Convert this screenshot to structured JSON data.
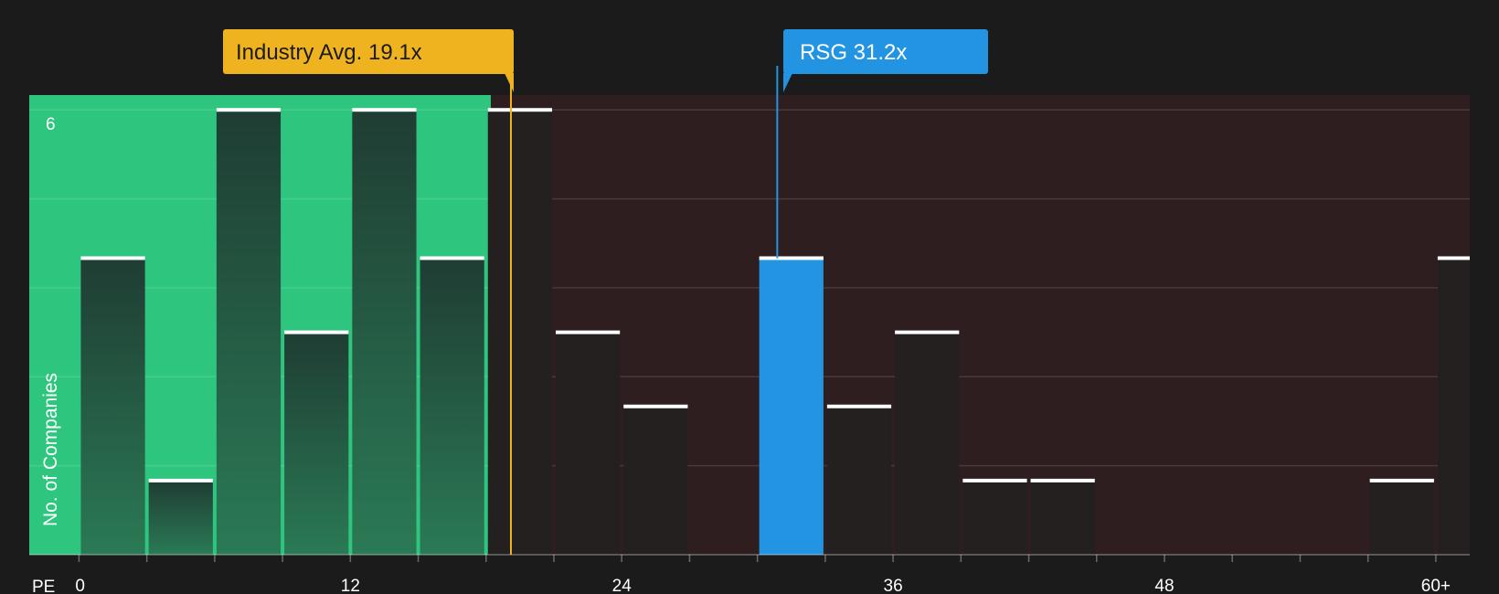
{
  "chart_data": {
    "type": "bar",
    "xlabel": "PE",
    "ylabel": "No. of Companies",
    "x_ticks": [
      {
        "value": 0,
        "label": "0"
      },
      {
        "value": 12,
        "label": "12"
      },
      {
        "value": 24,
        "label": "24"
      },
      {
        "value": 36,
        "label": "36"
      },
      {
        "value": 48,
        "label": "48"
      },
      {
        "value": 60,
        "label": "60+"
      }
    ],
    "y_ticks": [
      {
        "value": 6,
        "label": "6"
      }
    ],
    "xlim": [
      -2.2,
      61.5
    ],
    "ylim": [
      0,
      6.2
    ],
    "bin_width": 3,
    "bins": [
      {
        "start": 0,
        "count": 4
      },
      {
        "start": 3,
        "count": 1
      },
      {
        "start": 6,
        "count": 6
      },
      {
        "start": 9,
        "count": 3
      },
      {
        "start": 12,
        "count": 6
      },
      {
        "start": 15,
        "count": 4
      },
      {
        "start": 18,
        "count": 6
      },
      {
        "start": 21,
        "count": 3
      },
      {
        "start": 24,
        "count": 2
      },
      {
        "start": 30,
        "count": 4,
        "highlight": true
      },
      {
        "start": 33,
        "count": 2
      },
      {
        "start": 36,
        "count": 3
      },
      {
        "start": 39,
        "count": 1
      },
      {
        "start": 42,
        "count": 1
      },
      {
        "start": 57,
        "count": 1
      },
      {
        "start": 60,
        "count": 4
      }
    ],
    "markers": {
      "industry": {
        "label": "Industry Avg. 19.1x",
        "value": 19.1,
        "color": "#efb31f"
      },
      "company": {
        "label": "RSG 31.2x",
        "value": 31.2,
        "color": "#2394e2"
      }
    },
    "colors": {
      "background": "#1b1b1b",
      "undervalued_region": "#2ec67e",
      "overvalued_region": "#2f1e1f",
      "bar_on_green": "#22483a",
      "bar_on_red": "#242020",
      "highlight_bar": "#2394e2",
      "bar_cap": "#ffffff"
    },
    "grid": true
  }
}
